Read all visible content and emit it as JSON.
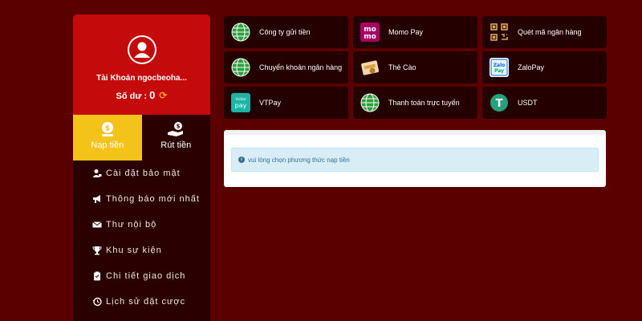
{
  "profile": {
    "account_label": "Tài Khoản ngocbeoha...",
    "balance_label": "Số dư :",
    "balance_value": "0"
  },
  "tabs": [
    {
      "label": "Nạp tiền",
      "icon": "deposit-icon",
      "active": true
    },
    {
      "label": "Rút tiền",
      "icon": "withdraw-icon",
      "active": false
    }
  ],
  "menu": [
    {
      "label": "Cài đặt bảo mật",
      "icon": "user-lock-icon"
    },
    {
      "label": "Thông báo mới nhất",
      "icon": "megaphone-icon"
    },
    {
      "label": "Thư nội bộ",
      "icon": "envelope-icon"
    },
    {
      "label": "Khu sự kiện",
      "icon": "trophy-icon"
    },
    {
      "label": "Chi tiết giao dịch",
      "icon": "clipboard-icon"
    },
    {
      "label": "Lịch sử đặt cược",
      "icon": "history-icon"
    }
  ],
  "payments": [
    {
      "label": "Công ty gửi tiền",
      "icon": "globe-icon"
    },
    {
      "label": "Momo Pay",
      "icon": "momo-icon"
    },
    {
      "label": "Quét mã ngân hàng",
      "icon": "qr-code-icon"
    },
    {
      "label": "Chuyển khoản ngân hàng",
      "icon": "globe-icon"
    },
    {
      "label": "Thẻ Cào",
      "icon": "scratch-card-icon"
    },
    {
      "label": "ZaloPay",
      "icon": "zalopay-icon"
    },
    {
      "label": "VTPay",
      "icon": "vtpay-icon"
    },
    {
      "label": "Thanh toán trực tuyến",
      "icon": "globe-icon"
    },
    {
      "label": "USDT",
      "icon": "usdt-icon"
    }
  ],
  "info_message": "vui lòng chọn phương thức nạp tiền",
  "brand_text": {
    "momo_top": "mo",
    "momo_bottom": "mo",
    "zalo_top": "Zalo",
    "zalo_bottom": "Pay",
    "vt_top": "Viettel",
    "vt_bottom": "pay",
    "usdt_symbol": "T"
  },
  "colors": {
    "background": "#5a0000",
    "profile_red": "#c40a0a",
    "active_tab": "#f3c319",
    "panel_dark": "#250000",
    "info_bg": "#d9edf7",
    "info_text": "#31708f"
  }
}
